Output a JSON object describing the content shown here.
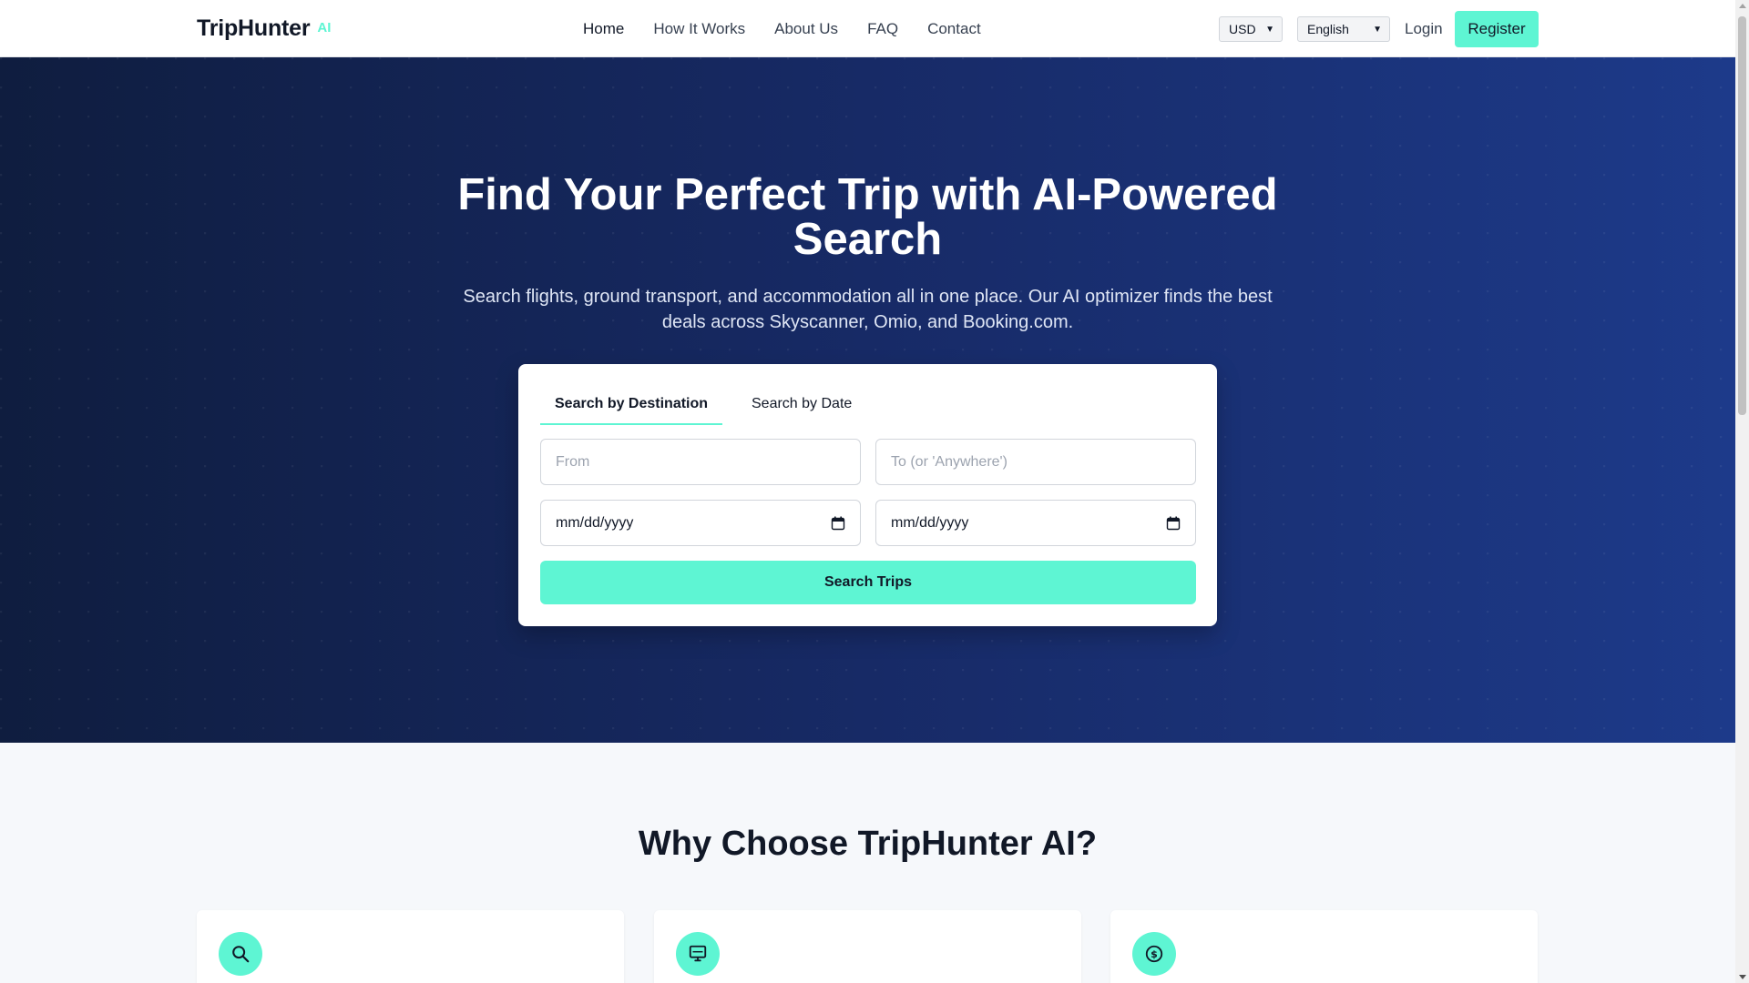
{
  "header": {
    "logo": "TripHunter",
    "logo_suffix": "AI",
    "nav": [
      "Home",
      "How It Works",
      "About Us",
      "FAQ",
      "Contact"
    ],
    "currency": "USD",
    "language": "English",
    "login": "Login",
    "register": "Register"
  },
  "hero": {
    "title": "Find Your Perfect Trip with AI-Powered Search",
    "subtitle": "Search flights, ground transport, and accommodation all in one place. Our AI optimizer finds the best deals across Skyscanner, Omio, and Booking.com."
  },
  "search": {
    "tabs": [
      "Search by Destination",
      "Search by Date"
    ],
    "active_tab": "Search by Destination",
    "from_placeholder": "From",
    "to_placeholder": "To (or 'Anywhere')",
    "date_start": "mm/dd/yyyy",
    "date_end": "mm/dd/yyyy",
    "button": "Search Trips"
  },
  "features": {
    "heading": "Why Choose TripHunter AI?",
    "cards": [
      {
        "icon": "search-icon"
      },
      {
        "icon": "monitor-icon"
      },
      {
        "icon": "dollar-icon"
      }
    ]
  },
  "colors": {
    "accent": "#5ef5d3",
    "hero_dark": "#0f1d3f",
    "hero_light": "#1d3a8a"
  }
}
